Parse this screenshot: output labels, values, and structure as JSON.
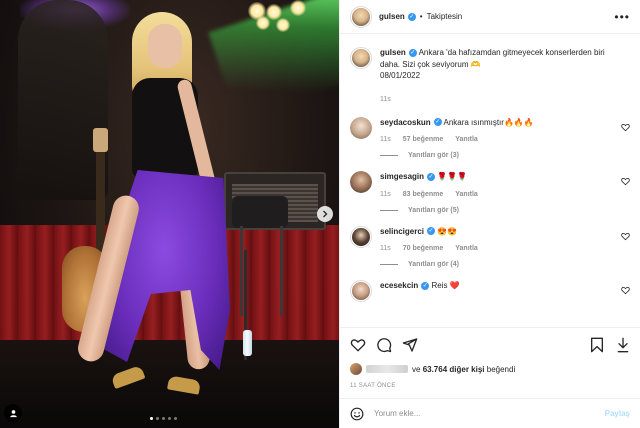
{
  "post": {
    "image_alt_icons": [
      "next-arrow-icon",
      "tag-user-icon"
    ],
    "carousel_count": 5,
    "carousel_active": 0
  },
  "header": {
    "username": "gulsen",
    "separator": "•",
    "follow_status": "Takiptesin",
    "more_icon": "more-horizontal-icon"
  },
  "caption": {
    "username": "gulsen",
    "text": "Ankara 'da hafızamdan gitmeyecek konserlerden biri daha. Sizi çok seviyorum",
    "emoji": "🫶",
    "date": "08/01/2022",
    "time": "11s"
  },
  "comments": [
    {
      "username": "seydacoskun",
      "text": "Ankara ısınmıştır🔥🔥🔥",
      "time": "11s",
      "likes": "57 beğenme",
      "reply": "Yanıtla",
      "replies": "Yanıtları gör (3)"
    },
    {
      "username": "simgesagin",
      "text": "🌹🌹🌹",
      "time": "11s",
      "likes": "83 beğenme",
      "reply": "Yanıtla",
      "replies": "Yanıtları gör (5)"
    },
    {
      "username": "selincigerci",
      "text": "😍😍",
      "time": "11s",
      "likes": "70 beğenme",
      "reply": "Yanıtla",
      "replies": "Yanıtları gör (4)"
    },
    {
      "username": "ecesekcin",
      "text": "Reis ❤️",
      "time": "",
      "likes": "",
      "reply": "",
      "replies": ""
    }
  ],
  "likes": {
    "prefix": "ve",
    "count": "63.764",
    "suffix": "diğer kişi",
    "verb": "beğendi"
  },
  "time_ago": "11 SAAT ÖNCE",
  "add_comment": {
    "placeholder": "Yorum ekle...",
    "submit": "Paylaş"
  },
  "colors": {
    "verified": "#3897f0",
    "link_disabled": "#b2dffc",
    "secondary_text": "#8e8e8e",
    "purple_feather": "#7a3cd0"
  }
}
